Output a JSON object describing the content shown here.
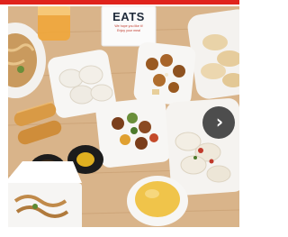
{
  "image": {
    "subject": "overhead food photo",
    "sign": {
      "title": "EATS",
      "subtitle_line1": "We hope you like it!",
      "subtitle_line2": "Enjoy your meal"
    }
  },
  "carousel": {
    "next_icon": "chevron-right-icon",
    "next_glyph": "›"
  },
  "colors": {
    "accent": "#e0231c",
    "button": "#282828"
  }
}
